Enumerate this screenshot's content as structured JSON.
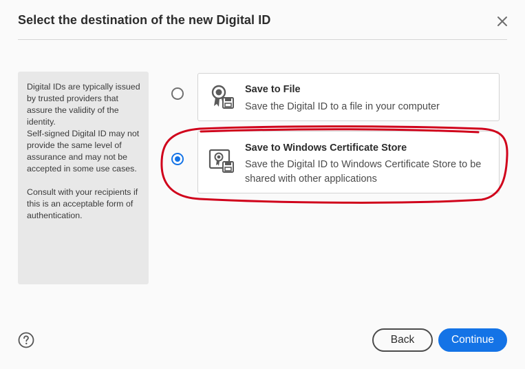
{
  "dialog": {
    "title": "Select the destination of the new Digital ID",
    "close_icon": "close-icon"
  },
  "info_panel": {
    "paragraph1": "Digital IDs are typically issued by trusted providers that assure the validity of the identity.",
    "paragraph2": "Self-signed Digital ID may not provide the same level of assurance and may not be accepted in some use cases.",
    "paragraph3": "Consult with your recipients if this is an acceptable form of authentication."
  },
  "options": [
    {
      "title": "Save to File",
      "description": "Save the Digital ID to a file in your computer",
      "icon": "certificate-save-icon",
      "selected": false
    },
    {
      "title": "Save to Windows Certificate Store",
      "description": "Save the Digital ID to Windows Certificate Store to be shared with other applications",
      "icon": "certificate-store-icon",
      "selected": true
    }
  ],
  "footer": {
    "help_icon": "help-icon",
    "back_label": "Back",
    "continue_label": "Continue"
  },
  "colors": {
    "accent": "#1473e6",
    "annotation": "#d0021b"
  }
}
